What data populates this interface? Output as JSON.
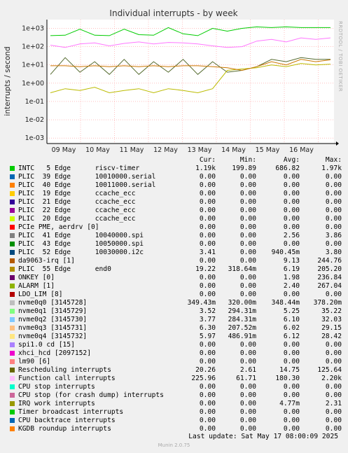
{
  "chart_data": {
    "type": "line",
    "title": "Individual interrupts - by week",
    "ylabel": "interrupts / second",
    "yscale": "log",
    "ylim": [
      0.0005,
      3000
    ],
    "yticks": [
      "1e+03",
      "1e+02",
      "1e+01",
      "1e+00",
      "1e-01",
      "1e-02",
      "1e-03"
    ],
    "xticks": [
      "09 May",
      "10 May",
      "11 May",
      "12 May",
      "13 May",
      "14 May",
      "15 May",
      "16 May"
    ],
    "series_preview": [
      {
        "name": "INTC 5 Edge riscv-timer",
        "color": "#00cc00",
        "values": [
          400,
          420,
          900,
          420,
          400,
          900,
          450,
          420,
          1100,
          500,
          400,
          1000,
          700,
          1000,
          1200,
          1100,
          1200,
          1100,
          1100,
          1100
        ]
      },
      {
        "name": "Function call interrupts",
        "color": "#ff77ff",
        "values": [
          120,
          90,
          140,
          160,
          110,
          150,
          180,
          140,
          170,
          160,
          140,
          110,
          90,
          100,
          200,
          250,
          180,
          300,
          250,
          300
        ]
      },
      {
        "name": "Rescheduling interrupts",
        "color": "#556b2f",
        "values": [
          3,
          25,
          4,
          15,
          3,
          20,
          3,
          15,
          4,
          20,
          3,
          15,
          4,
          5,
          8,
          20,
          15,
          25,
          20,
          20
        ]
      },
      {
        "name": "nvme0q0 [3145728]",
        "color": "#bbbb00",
        "values": [
          0.3,
          0.5,
          0.4,
          0.6,
          0.3,
          0.4,
          0.5,
          0.3,
          0.5,
          0.4,
          0.3,
          0.5,
          5,
          6,
          7,
          10,
          8,
          12,
          10,
          11
        ]
      },
      {
        "name": "PLIC 55 Edge end0",
        "color": "#cc7700",
        "values": [
          9,
          9,
          8,
          9,
          8,
          9,
          8,
          9,
          8,
          9,
          9,
          8,
          7,
          5,
          8,
          15,
          10,
          20,
          15,
          19
        ]
      }
    ]
  },
  "legend": {
    "headers": {
      "cur": "Cur:",
      "min": "Min:",
      "avg": "Avg:",
      "max": "Max:"
    },
    "rows": [
      {
        "color": "#00cc00",
        "label": "INTC   5 Edge      riscv-timer",
        "cur": "1.19k",
        "min": "199.89",
        "avg": "686.82",
        "max": "1.97k"
      },
      {
        "color": "#0066b3",
        "label": "PLIC  39 Edge      10010000.serial",
        "cur": "0.00",
        "min": "0.00",
        "avg": "0.00",
        "max": "0.00"
      },
      {
        "color": "#ff8000",
        "label": "PLIC  40 Edge      10011000.serial",
        "cur": "0.00",
        "min": "0.00",
        "avg": "0.00",
        "max": "0.00"
      },
      {
        "color": "#ffcc00",
        "label": "PLIC  19 Edge      ccache_ecc",
        "cur": "0.00",
        "min": "0.00",
        "avg": "0.00",
        "max": "0.00"
      },
      {
        "color": "#330099",
        "label": "PLIC  21 Edge      ccache_ecc",
        "cur": "0.00",
        "min": "0.00",
        "avg": "0.00",
        "max": "0.00"
      },
      {
        "color": "#990099",
        "label": "PLIC  22 Edge      ccache_ecc",
        "cur": "0.00",
        "min": "0.00",
        "avg": "0.00",
        "max": "0.00"
      },
      {
        "color": "#ccff00",
        "label": "PLIC  20 Edge      ccache_ecc",
        "cur": "0.00",
        "min": "0.00",
        "avg": "0.00",
        "max": "0.00"
      },
      {
        "color": "#ff0000",
        "label": "PCIe PME, aerdrv [0]",
        "cur": "0.00",
        "min": "0.00",
        "avg": "0.00",
        "max": "0.00"
      },
      {
        "color": "#808080",
        "label": "PLIC  41 Edge      10040000.spi",
        "cur": "0.00",
        "min": "0.00",
        "avg": "2.56",
        "max": "3.86"
      },
      {
        "color": "#008f00",
        "label": "PLIC  43 Edge      10050000.spi",
        "cur": "0.00",
        "min": "0.00",
        "avg": "0.00",
        "max": "0.00"
      },
      {
        "color": "#00487d",
        "label": "PLIC  52 Edge      10030000.i2c",
        "cur": "3.41",
        "min": "0.00",
        "avg": "940.45m",
        "max": "3.80"
      },
      {
        "color": "#b35a00",
        "label": "da9063-irq [1]",
        "cur": "0.00",
        "min": "0.00",
        "avg": "9.13",
        "max": "244.76"
      },
      {
        "color": "#b38f00",
        "label": "PLIC  55 Edge      end0",
        "cur": "19.22",
        "min": "318.64m",
        "avg": "6.19",
        "max": "205.20"
      },
      {
        "color": "#6b006b",
        "label": "ONKEY [0]",
        "cur": "0.00",
        "min": "0.00",
        "avg": "1.98",
        "max": "236.84"
      },
      {
        "color": "#8fb300",
        "label": "ALARM [1]",
        "cur": "0.00",
        "min": "0.00",
        "avg": "2.40",
        "max": "267.04"
      },
      {
        "color": "#b30000",
        "label": "LDO_LIM [8]",
        "cur": "0.00",
        "min": "0.00",
        "avg": "0.00",
        "max": "0.00"
      },
      {
        "color": "#bebebe",
        "label": "nvme0q0 [3145728]",
        "cur": "349.43m",
        "min": "320.00m",
        "avg": "348.44m",
        "max": "378.20m"
      },
      {
        "color": "#80ff80",
        "label": "nvme0q1 [3145729]",
        "cur": "3.52",
        "min": "294.31m",
        "avg": "5.25",
        "max": "35.22"
      },
      {
        "color": "#80c9ff",
        "label": "nvme0q2 [3145730]",
        "cur": "3.77",
        "min": "284.31m",
        "avg": "6.10",
        "max": "32.03"
      },
      {
        "color": "#ffc080",
        "label": "nvme0q3 [3145731]",
        "cur": "6.30",
        "min": "207.52m",
        "avg": "6.02",
        "max": "29.15"
      },
      {
        "color": "#ffe680",
        "label": "nvme0q4 [3145732]",
        "cur": "5.97",
        "min": "486.91m",
        "avg": "6.12",
        "max": "28.42"
      },
      {
        "color": "#aa80ff",
        "label": "spi1.0 cd [15]",
        "cur": "0.00",
        "min": "0.00",
        "avg": "0.00",
        "max": "0.00"
      },
      {
        "color": "#ee00cc",
        "label": "xhci_hcd [2097152]",
        "cur": "0.00",
        "min": "0.00",
        "avg": "0.00",
        "max": "0.00"
      },
      {
        "color": "#ff8080",
        "label": "lm90 [6]",
        "cur": "0.00",
        "min": "0.00",
        "avg": "0.00",
        "max": "0.00"
      },
      {
        "color": "#666600",
        "label": "Rescheduling interrupts",
        "cur": "20.26",
        "min": "2.61",
        "avg": "14.75",
        "max": "125.64"
      },
      {
        "color": "#ffbfff",
        "label": "Function call interrupts",
        "cur": "225.96",
        "min": "61.71",
        "avg": "180.30",
        "max": "2.20k"
      },
      {
        "color": "#00ffcc",
        "label": "CPU stop interrupts",
        "cur": "0.00",
        "min": "0.00",
        "avg": "0.00",
        "max": "0.00"
      },
      {
        "color": "#cc6699",
        "label": "CPU stop (for crash dump) interrupts",
        "cur": "0.00",
        "min": "0.00",
        "avg": "0.00",
        "max": "0.00"
      },
      {
        "color": "#999900",
        "label": "IRQ work interrupts",
        "cur": "0.00",
        "min": "0.00",
        "avg": "4.77m",
        "max": "2.31"
      },
      {
        "color": "#00cc00",
        "label": "Timer broadcast interrupts",
        "cur": "0.00",
        "min": "0.00",
        "avg": "0.00",
        "max": "0.00"
      },
      {
        "color": "#0066b3",
        "label": "CPU backtrace interrupts",
        "cur": "0.00",
        "min": "0.00",
        "avg": "0.00",
        "max": "0.00"
      },
      {
        "color": "#ff8000",
        "label": "KGDB roundup interrupts",
        "cur": "0.00",
        "min": "0.00",
        "avg": "0.00",
        "max": "0.00"
      }
    ]
  },
  "footer": {
    "last_update": "Last update: Sat May 17 08:00:09 2025"
  },
  "side_label": "RRDTOOL / TOBI OETIKER",
  "munin_version": "Munin 2.0.75"
}
